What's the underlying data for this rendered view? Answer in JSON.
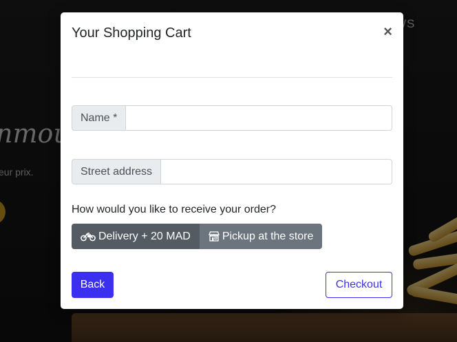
{
  "background": {
    "nav_text": "WS",
    "script_text": "nmou",
    "subtitle": "eur prix."
  },
  "modal": {
    "title": "Your Shopping Cart",
    "close_label": "×",
    "name_label": "Name *",
    "name_value": "",
    "street_label": "Street address",
    "street_value": "",
    "question": "How would you like to receive your order?",
    "delivery_label": "Delivery + 20 MAD",
    "pickup_label": "Pickup at the store",
    "selected_option": "Delivery + 20 MAD",
    "back_label": "Back",
    "checkout_label": "Checkout"
  },
  "colors": {
    "primary": "#3b30f0",
    "toggle_active": "#545b62",
    "toggle_inactive": "#6c757d"
  },
  "icons": {
    "delivery": "motorcycle-icon",
    "pickup": "store-icon",
    "close": "close-icon"
  }
}
